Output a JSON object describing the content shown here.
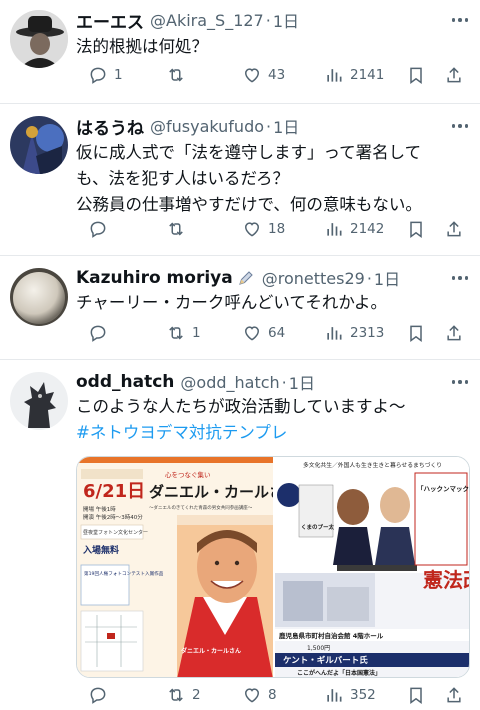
{
  "tweets": [
    {
      "name": "エーエス",
      "handle": "@Akira_S_127",
      "time": "1日",
      "lines": [
        "法的根拠は何処？"
      ],
      "reply": "1",
      "retweet": "",
      "like": "43",
      "views": "2141"
    },
    {
      "name": "はるうね",
      "handle": "@fusyakufudo",
      "time": "1日",
      "lines": [
        "仮に成人式で「法を遵守します」って署名して",
        "も、法を犯す人はいるだろ？",
        "公務員の仕事増やすだけで、何の意味もない。"
      ],
      "reply": "",
      "retweet": "",
      "like": "18",
      "views": "2142"
    },
    {
      "name": "Kazuhiro moriya",
      "handle": "@ronettes29",
      "time": "1日",
      "lines": [
        "チャーリー・カーク呼んどいてそれかよ。"
      ],
      "reply": "",
      "retweet": "1",
      "like": "64",
      "views": "2313"
    },
    {
      "name": "odd_hatch",
      "handle": "@odd_hatch",
      "time": "1日",
      "lines": [
        "このような人たちが政治活動していますよ〜"
      ],
      "hashtag": "#ネトウヨデマ対抗テンプレ",
      "reply": "",
      "retweet": "2",
      "like": "8",
      "views": "352"
    }
  ],
  "flyer_left": {
    "top_tag": "心をつなぐ集い",
    "title": "ダニエル・カールさん講演会",
    "subtitle": "〜ダニエルのきてくれた青森の男女共同参画講座〜",
    "date": "6/21日",
    "time_line1": "開場 午後1時",
    "time_line2": "開演 午後2時〜3時40分",
    "venue": "昼夜堂フォトン文化センター",
    "free": "入場無料",
    "event_label": "第19回人権フォトコンテスト入賞作品",
    "speaker_name": "ダニエル・カールさん"
  },
  "flyer_right": {
    "top_tag": "多文化共生／外国人も生き生きと暮らせるまちづくり",
    "headline": "「ハックンマックンとこれからの集い」",
    "vertical": "憲法改正を！",
    "location": "鹿児島県市町村自治会館 4階ホール",
    "price": "1,500円",
    "speaker": "ケント・ギルバート氏",
    "footer": "ここがへんだよ「日本国憲法」",
    "bubble": "くまのプー太"
  },
  "colors": {
    "accent": "#1d9bf0",
    "text": "#0f1419",
    "muted": "#536471",
    "flyer_red": "#c0261c",
    "flyer_orange": "#e8742a",
    "flyer_navy": "#1c2f6b"
  }
}
